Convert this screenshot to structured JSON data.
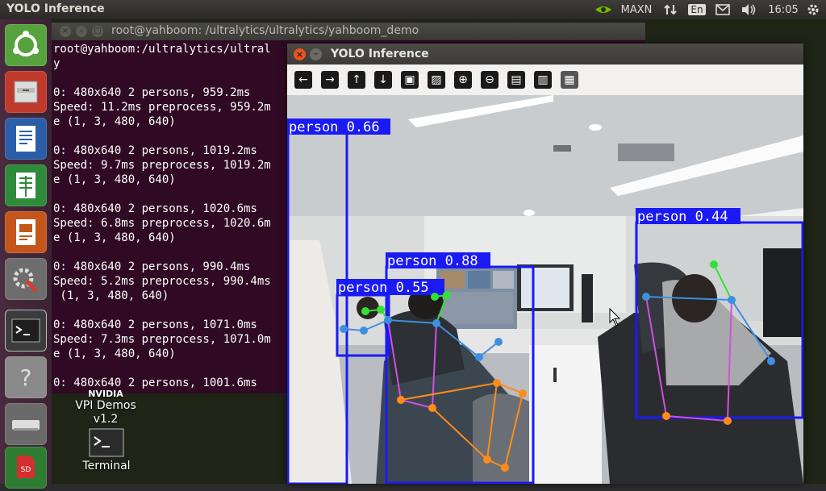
{
  "topbar": {
    "app_title": "YOLO Inference",
    "power_mode": "MAXN",
    "keyboard_layout": "En",
    "clock": "16:05"
  },
  "terminal": {
    "title": "root@yahboom: /ultralytics/ultralytics/yahboom_demo",
    "lines": [
      "root@yahboom:/ultralytics/ultral",
      "y",
      "",
      "0: 480x640 2 persons, 959.2ms",
      "Speed: 11.2ms preprocess, 959.2m",
      "e (1, 3, 480, 640)",
      "",
      "0: 480x640 2 persons, 1019.2ms",
      "Speed: 9.7ms preprocess, 1019.2m",
      "e (1, 3, 480, 640)",
      "",
      "0: 480x640 2 persons, 1020.6ms",
      "Speed: 6.8ms preprocess, 1020.6m",
      "e (1, 3, 480, 640)",
      "",
      "0: 480x640 2 persons, 990.4ms",
      "Speed: 5.2ms preprocess, 990.4ms",
      " (1, 3, 480, 640)",
      "",
      "0: 480x640 2 persons, 1071.0ms",
      "Speed: 7.3ms preprocess, 1071.0m",
      "e (1, 3, 480, 640)",
      "",
      "0: 480x640 2 persons, 1001.6ms"
    ]
  },
  "desktop": {
    "vpi_brand": "NVIDIA",
    "vpi_label": "VPI Demos",
    "vpi_version": "v1.2",
    "terminal_icon_label": "Terminal"
  },
  "yolo_window": {
    "title": "YOLO Inference",
    "detections": [
      {
        "label": "person 0.66"
      },
      {
        "label": "person 0.88"
      },
      {
        "label": "person 0.55"
      },
      {
        "label": "person 0.44"
      }
    ]
  },
  "colors": {
    "box": "#1a1af5",
    "limb_arm": "#3d8fe0",
    "limb_leg": "#ff8c1a",
    "limb_torso": "#d050e0",
    "limb_head": "#35e035",
    "terminal_bg": "#300a24",
    "accent": "#e95420"
  },
  "icons": {
    "launcher": [
      "ubuntu-dash-icon",
      "files-icon",
      "writer-icon",
      "calc-icon",
      "impress-icon",
      "settings-icon",
      "terminal-icon",
      "help-icon",
      "drive-icon",
      "sd-card-icon"
    ],
    "tray": [
      "nvidia-icon",
      "network-icon",
      "keyboard-icon",
      "mail-icon",
      "volume-icon",
      "gear-icon"
    ],
    "toolbar": [
      "back-arrow-icon",
      "forward-arrow-icon",
      "up-arrow-icon",
      "down-arrow-icon",
      "image-icon",
      "image-settings-icon",
      "zoom-in-icon",
      "zoom-out-icon",
      "save-icon",
      "clipboard-icon",
      "properties-icon"
    ]
  }
}
